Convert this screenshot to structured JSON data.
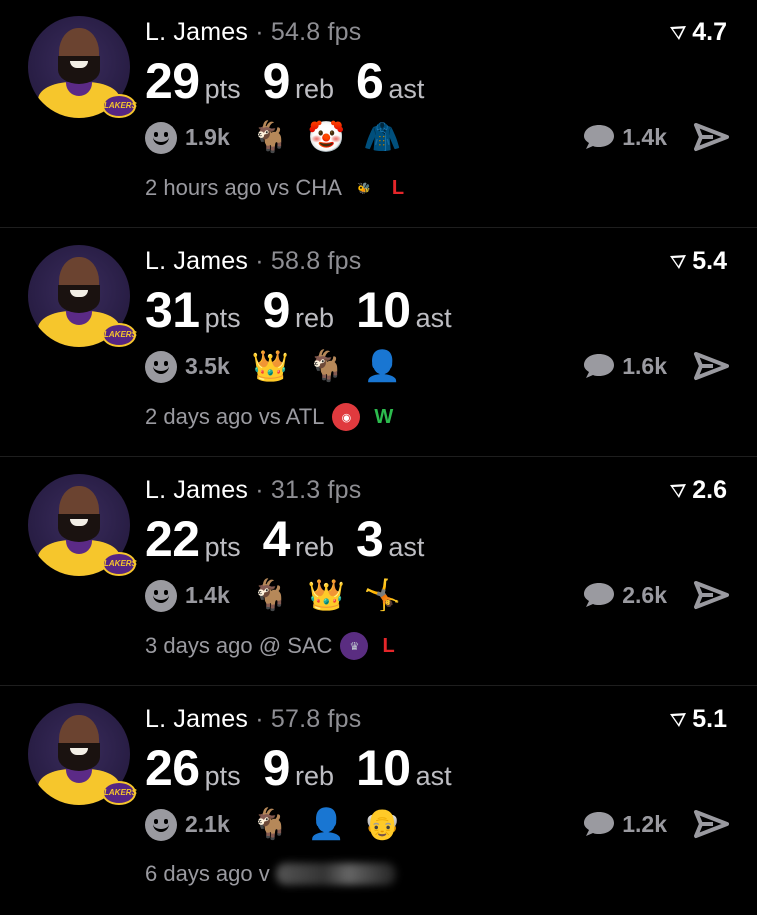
{
  "posts": [
    {
      "name": "L. James",
      "separator": "·",
      "fps": "54.8 fps",
      "rating": "4.7",
      "pts": "29",
      "pts_label": "pts",
      "reb": "9",
      "reb_label": "reb",
      "ast": "6",
      "ast_label": "ast",
      "likes": "1.9k",
      "reactions": [
        "goat",
        "clown",
        "hoodie-figure"
      ],
      "reaction_glyphs": [
        "🐐",
        "🤡",
        "🧥"
      ],
      "comments": "1.4k",
      "time": "2 hours ago vs CHA",
      "opponent": "CHA",
      "result": "L",
      "result_color": "#e5262a"
    },
    {
      "name": "L. James",
      "separator": "·",
      "fps": "58.8 fps",
      "rating": "5.4",
      "pts": "31",
      "pts_label": "pts",
      "reb": "9",
      "reb_label": "reb",
      "ast": "10",
      "ast_label": "ast",
      "likes": "3.5k",
      "reactions": [
        "crown",
        "goat",
        "bald-person"
      ],
      "reaction_glyphs": [
        "👑",
        "🐐",
        "👤"
      ],
      "comments": "1.6k",
      "time": "2 days ago vs ATL",
      "opponent": "ATL",
      "result": "W",
      "result_color": "#2dbb4e"
    },
    {
      "name": "L. James",
      "separator": "·",
      "fps": "31.3 fps",
      "rating": "2.6",
      "pts": "22",
      "pts_label": "pts",
      "reb": "4",
      "reb_label": "reb",
      "ast": "3",
      "ast_label": "ast",
      "likes": "1.4k",
      "reactions": [
        "goat",
        "crown",
        "dancer"
      ],
      "reaction_glyphs": [
        "🐐",
        "👑",
        "🤸"
      ],
      "comments": "2.6k",
      "time": "3 days ago @ SAC",
      "opponent": "SAC",
      "result": "L",
      "result_color": "#e5262a"
    },
    {
      "name": "L. James",
      "separator": "·",
      "fps": "57.8 fps",
      "rating": "5.1",
      "pts": "26",
      "pts_label": "pts",
      "reb": "9",
      "reb_label": "reb",
      "ast": "10",
      "ast_label": "ast",
      "likes": "2.1k",
      "reactions": [
        "goat",
        "bald-person",
        "old-man"
      ],
      "reaction_glyphs": [
        "🐐",
        "👤",
        "👴"
      ],
      "comments": "1.2k",
      "time": "6 days ago v",
      "opponent": "",
      "result": "",
      "result_color": ""
    }
  ],
  "team_badge": "LAKERS",
  "colors": {
    "bg": "#000000",
    "muted": "#9a9aa0",
    "loss": "#e5262a",
    "win": "#2dbb4e",
    "lakers_purple": "#552583",
    "lakers_gold": "#f6c62c"
  }
}
